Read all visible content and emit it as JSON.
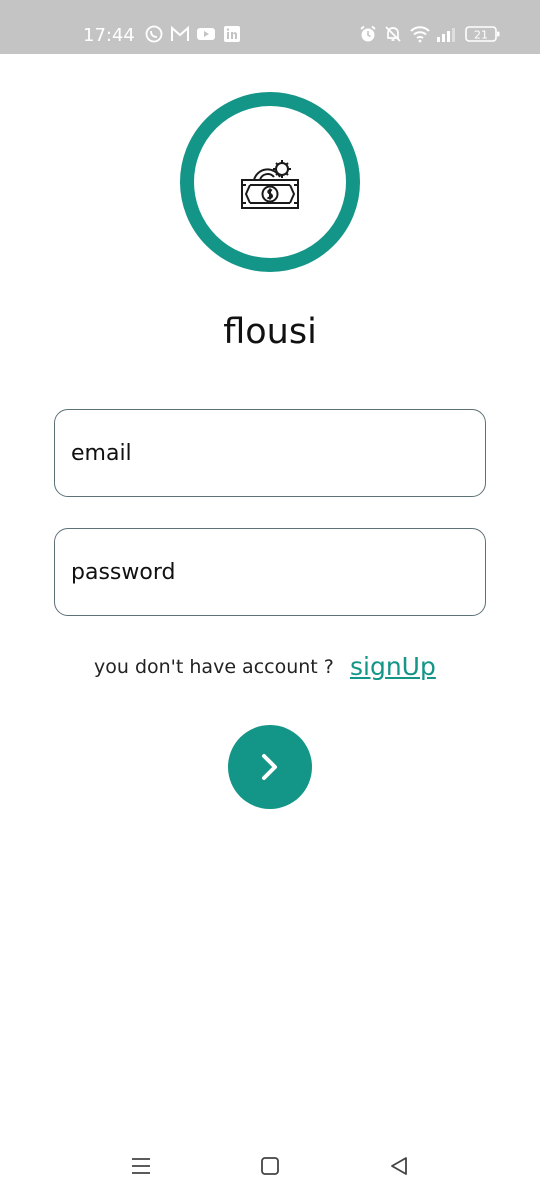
{
  "status_bar": {
    "time": "17:44",
    "notification_icons": [
      "whatsapp-icon",
      "gmail-icon",
      "youtube-icon",
      "linkedin-icon"
    ],
    "system_icons": [
      "alarm-icon",
      "mute-icon",
      "wifi-icon",
      "signal-icon",
      "battery-icon"
    ],
    "battery_level": "21"
  },
  "app": {
    "name": "flousi",
    "logo_icon": "money-gear-icon",
    "accent_color": "#139587"
  },
  "login_form": {
    "email_placeholder": "email",
    "password_placeholder": "password",
    "account_prompt": "you don't have account ?",
    "signup_link": "signUp",
    "submit_icon": "chevron-right-icon"
  },
  "nav_bar": {
    "buttons": [
      "recents-icon",
      "home-icon",
      "back-icon"
    ]
  }
}
